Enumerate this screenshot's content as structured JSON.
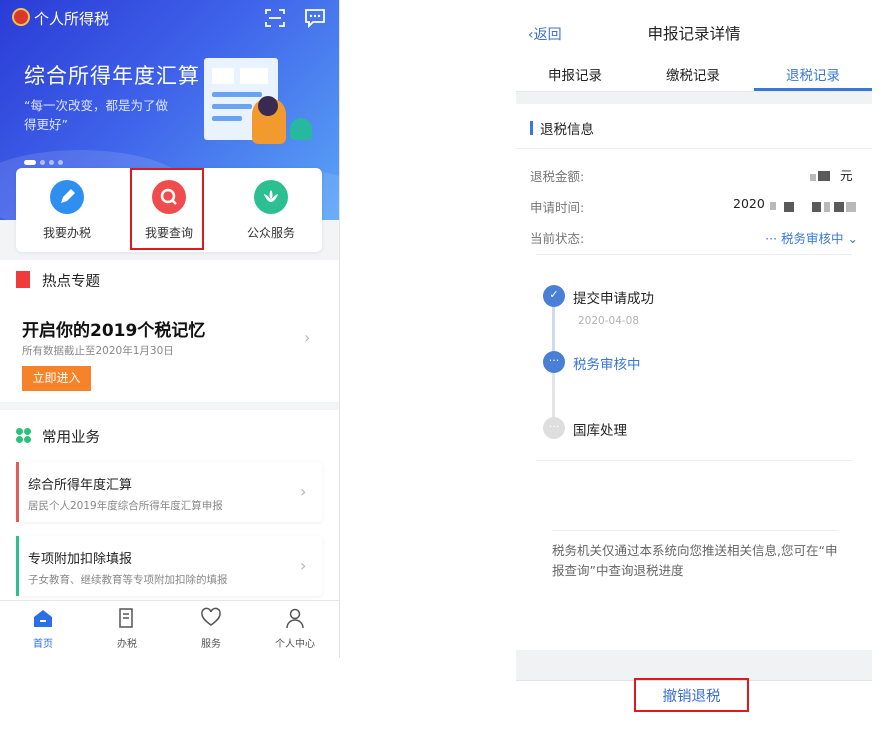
{
  "left": {
    "app_title": "个人所得税",
    "banner": {
      "title": "综合所得年度汇算",
      "subtitle": "“每一次改变，都是为了做得更好”"
    },
    "services": [
      {
        "label": "我要办税",
        "color": "#2f8ff0"
      },
      {
        "label": "我要查询",
        "color": "#ef4d4d"
      },
      {
        "label": "公众服务",
        "color": "#2cbf8f"
      }
    ],
    "hot": {
      "section_title": "热点专题",
      "headline": "开启你的2019个税记忆",
      "note": "所有数据截止至2020年1月30日",
      "enter_button": "立即进入"
    },
    "business": {
      "section_title": "常用业务",
      "items": [
        {
          "title": "综合所得年度汇算",
          "desc": "居民个人2019年度综合所得年度汇算申报",
          "color": "#e25c5c"
        },
        {
          "title": "专项附加扣除填报",
          "desc": "子女教育、继续教育等专项附加扣除的填报",
          "color": "#2cbf8f"
        }
      ]
    },
    "tabbar": [
      "首页",
      "办税",
      "服务",
      "个人中心"
    ]
  },
  "right": {
    "back_label": "返回",
    "title": "申报记录详情",
    "tabs": [
      "申报记录",
      "缴税记录",
      "退税记录"
    ],
    "section_title": "退税信息",
    "fields": {
      "amount_label": "退税金额:",
      "amount_unit": "元",
      "time_label": "申请时间:",
      "time_value": "2020",
      "status_label": "当前状态:",
      "status_value": "··· 税务审核中 ⌄"
    },
    "timeline": [
      {
        "label": "提交申请成功",
        "date": "2020-04-08",
        "state": "done"
      },
      {
        "label": "税务审核中",
        "state": "current"
      },
      {
        "label": "国库处理",
        "state": "pending"
      }
    ],
    "note": "税务机关仅通过本系统向您推送相关信息,您可在“申报查询”中查询退税进度",
    "cancel_button": "撤销退税"
  },
  "colors": {
    "accent_blue": "#3a78d8",
    "highlight_red": "#e0191c",
    "orange": "#f6832a"
  }
}
